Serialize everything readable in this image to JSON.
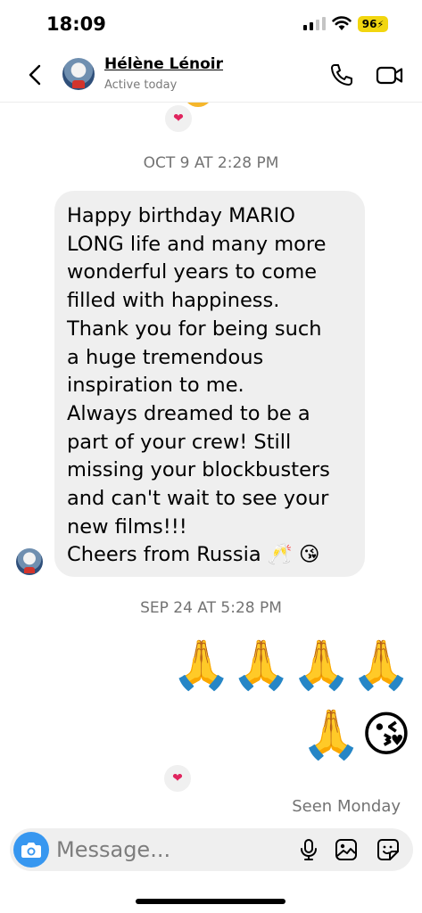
{
  "status_bar": {
    "time": "18:09",
    "battery": "96"
  },
  "header": {
    "contact_name": "Hélène Lénoir",
    "status": "Active today",
    "icons": [
      "back-icon",
      "call-icon",
      "video-icon"
    ]
  },
  "chat": {
    "timestamp_1": "OCT 9 AT 2:28 PM",
    "message_lines": [
      "Happy birthday MARIO",
      "LONG life and many more",
      "wonderful years to come",
      "filled with happiness.",
      "Thank you for being such",
      "a huge tremendous",
      "inspiration to me.",
      "Always dreamed to be a",
      "part of your crew! Still",
      "missing your blockbusters",
      "and can't wait to see your",
      "new films!!!",
      "Cheers from Russia 🥂 😘"
    ],
    "timestamp_2": "SEP 24 AT 5:28 PM",
    "emoji_row_1": "🙏🙏🙏🙏",
    "emoji_row_2": "🙏😘",
    "reaction": "❤",
    "seen": "Seen Monday"
  },
  "composer": {
    "placeholder": "Message..."
  },
  "colors": {
    "accent": "#3797f0",
    "bubble": "#efefef",
    "battery": "#f2d60f",
    "heart": "#e0245e"
  }
}
